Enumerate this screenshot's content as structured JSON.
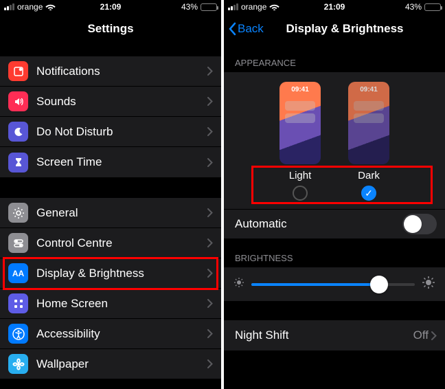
{
  "status": {
    "carrier": "orange",
    "time": "21:09",
    "battery_pct": "43%"
  },
  "left": {
    "title": "Settings",
    "group1": [
      {
        "label": "Notifications"
      },
      {
        "label": "Sounds"
      },
      {
        "label": "Do Not Disturb"
      },
      {
        "label": "Screen Time"
      }
    ],
    "group2": [
      {
        "label": "General"
      },
      {
        "label": "Control Centre"
      },
      {
        "label": "Display & Brightness"
      },
      {
        "label": "Home Screen"
      },
      {
        "label": "Accessibility"
      },
      {
        "label": "Wallpaper"
      }
    ]
  },
  "right": {
    "back_label": "Back",
    "title": "Display & Brightness",
    "appearance_header": "APPEARANCE",
    "mini_time": "09:41",
    "light_label": "Light",
    "dark_label": "Dark",
    "dark_selected": true,
    "automatic_label": "Automatic",
    "automatic_on": false,
    "brightness_header": "BRIGHTNESS",
    "brightness_value_pct": 78,
    "night_shift_label": "Night Shift",
    "night_shift_value": "Off"
  }
}
